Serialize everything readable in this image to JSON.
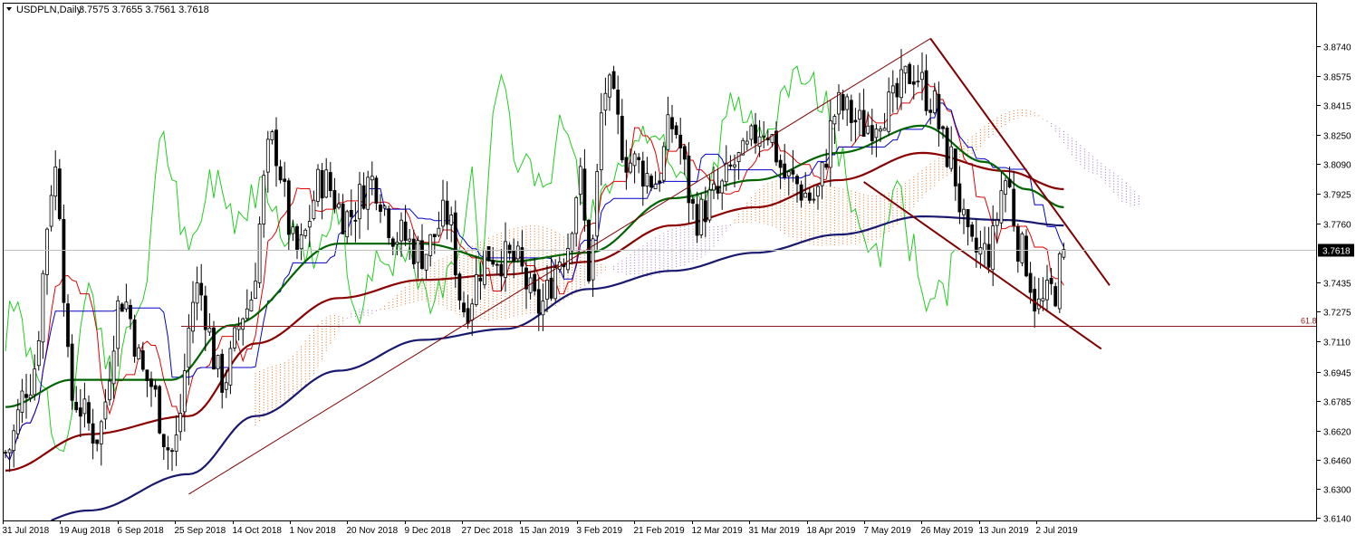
{
  "header": {
    "symbol": "USDPLN,Daily",
    "ohlc": "3.7575 3.7655 3.7561 3.7618"
  },
  "colors": {
    "background": "#ffffff",
    "frame": "#000000",
    "candle": "#000000",
    "sma_fast": "#006400",
    "sma_mid": "#8b0000",
    "sma_slow": "#191970",
    "tenkan": "#e00000",
    "kijun": "#0000cc",
    "chikou": "#22cc22",
    "cloud_a": "#e07020",
    "cloud_b": "#a070c0",
    "trendline": "#800000",
    "fib_line": "#8b1a1a",
    "price_line": "#c0c0c0",
    "current_price_bg": "#000000",
    "current_price_fg": "#ffffff"
  },
  "chart_data": {
    "type": "candlestick",
    "title": "USDPLN,Daily",
    "y_ticks": [
      "3.8740",
      "3.8575",
      "3.8415",
      "3.8250",
      "3.8090",
      "3.7925",
      "3.7760",
      "3.7435",
      "3.7275",
      "3.7110",
      "3.6945",
      "3.6785",
      "3.6620",
      "3.6460",
      "3.6300",
      "3.6140"
    ],
    "y_tick_values": [
      3.874,
      3.8575,
      3.8415,
      3.825,
      3.809,
      3.7925,
      3.776,
      3.7435,
      3.7275,
      3.711,
      3.6945,
      3.6785,
      3.662,
      3.646,
      3.63,
      3.614
    ],
    "ylim": [
      3.614,
      3.882
    ],
    "x_ticks": [
      "31 Jul 2018",
      "19 Aug 2018",
      "6 Sep 2018",
      "25 Sep 2018",
      "14 Oct 2018",
      "1 Nov 2018",
      "20 Nov 2018",
      "9 Dec 2018",
      "27 Dec 2018",
      "15 Jan 2019",
      "3 Feb 2019",
      "21 Feb 2019",
      "12 Mar 2019",
      "31 Mar 2019",
      "18 Apr 2019",
      "7 May 2019",
      "26 May 2019",
      "13 Jun 2019",
      "2 Jul 2019"
    ],
    "current_price": "3.7618",
    "current_price_value": 3.7618,
    "fib_level": {
      "label": "61.8",
      "value": 3.7195
    },
    "anchors": [
      [
        0,
        3.65
      ],
      [
        6,
        3.69
      ],
      [
        12,
        3.805
      ],
      [
        16,
        3.68
      ],
      [
        22,
        3.66
      ],
      [
        28,
        3.735
      ],
      [
        34,
        3.69
      ],
      [
        40,
        3.65
      ],
      [
        46,
        3.74
      ],
      [
        52,
        3.69
      ],
      [
        58,
        3.73
      ],
      [
        64,
        3.82
      ],
      [
        70,
        3.76
      ],
      [
        76,
        3.8
      ],
      [
        82,
        3.78
      ],
      [
        88,
        3.8
      ],
      [
        94,
        3.77
      ],
      [
        100,
        3.76
      ],
      [
        106,
        3.78
      ],
      [
        110,
        3.73
      ],
      [
        116,
        3.76
      ],
      [
        122,
        3.755
      ],
      [
        128,
        3.73
      ],
      [
        134,
        3.76
      ],
      [
        138,
        3.8
      ],
      [
        140,
        3.75
      ],
      [
        144,
        3.85
      ],
      [
        150,
        3.81
      ],
      [
        156,
        3.8
      ],
      [
        160,
        3.83
      ],
      [
        166,
        3.78
      ],
      [
        170,
        3.79
      ],
      [
        176,
        3.81
      ],
      [
        182,
        3.83
      ],
      [
        188,
        3.8
      ],
      [
        194,
        3.79
      ],
      [
        200,
        3.84
      ],
      [
        206,
        3.83
      ],
      [
        212,
        3.84
      ],
      [
        218,
        3.86
      ],
      [
        222,
        3.845
      ],
      [
        226,
        3.815
      ],
      [
        232,
        3.76
      ],
      [
        236,
        3.76
      ],
      [
        240,
        3.8
      ],
      [
        244,
        3.76
      ],
      [
        248,
        3.73
      ],
      [
        252,
        3.74
      ],
      [
        254,
        3.762
      ]
    ],
    "sma_fast": [
      [
        0,
        3.675
      ],
      [
        16,
        3.69
      ],
      [
        40,
        3.69
      ],
      [
        54,
        3.72
      ],
      [
        80,
        3.765
      ],
      [
        100,
        3.765
      ],
      [
        120,
        3.755
      ],
      [
        140,
        3.76
      ],
      [
        160,
        3.79
      ],
      [
        180,
        3.8
      ],
      [
        200,
        3.815
      ],
      [
        220,
        3.83
      ],
      [
        235,
        3.81
      ],
      [
        245,
        3.795
      ],
      [
        254,
        3.785
      ]
    ],
    "sma_mid": [
      [
        0,
        3.64
      ],
      [
        20,
        3.66
      ],
      [
        44,
        3.67
      ],
      [
        60,
        3.71
      ],
      [
        80,
        3.735
      ],
      [
        100,
        3.745
      ],
      [
        120,
        3.748
      ],
      [
        140,
        3.755
      ],
      [
        160,
        3.775
      ],
      [
        180,
        3.785
      ],
      [
        200,
        3.8
      ],
      [
        220,
        3.815
      ],
      [
        240,
        3.805
      ],
      [
        254,
        3.795
      ]
    ],
    "sma_slow": [
      [
        0,
        3.605
      ],
      [
        20,
        3.618
      ],
      [
        44,
        3.638
      ],
      [
        60,
        3.67
      ],
      [
        80,
        3.695
      ],
      [
        100,
        3.712
      ],
      [
        120,
        3.718
      ],
      [
        140,
        3.74
      ],
      [
        160,
        3.75
      ],
      [
        180,
        3.76
      ],
      [
        200,
        3.77
      ],
      [
        220,
        3.78
      ],
      [
        240,
        3.778
      ],
      [
        254,
        3.775
      ]
    ],
    "trendlines": [
      {
        "from": [
          44,
          3.627
        ],
        "to": [
          222,
          3.878
        ]
      },
      {
        "from": [
          222,
          3.878
        ],
        "to": [
          265,
          3.742
        ]
      },
      {
        "from": [
          206,
          3.799
        ],
        "to": [
          263,
          3.707
        ]
      }
    ],
    "cloud_start": 60,
    "cloud_end": 273
  }
}
